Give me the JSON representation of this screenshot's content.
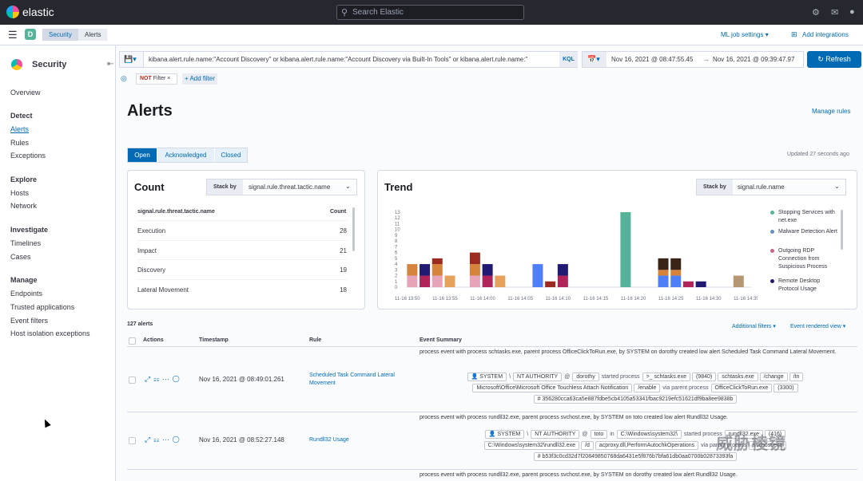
{
  "topbar": {
    "app_name": "elastic",
    "search_placeholder": "Search Elastic"
  },
  "header": {
    "space_badge": "D",
    "breadcrumbs": [
      "Security",
      "Alerts"
    ],
    "ml_job_settings": "ML job settings",
    "add_integrations": "Add integrations"
  },
  "sidebar": {
    "title": "Security",
    "items": [
      {
        "label": "Overview",
        "type": "link"
      },
      {
        "label": "Detect",
        "type": "heading"
      },
      {
        "label": "Alerts",
        "type": "link",
        "active": true
      },
      {
        "label": "Rules",
        "type": "link"
      },
      {
        "label": "Exceptions",
        "type": "link"
      },
      {
        "label": "Explore",
        "type": "heading"
      },
      {
        "label": "Hosts",
        "type": "link"
      },
      {
        "label": "Network",
        "type": "link"
      },
      {
        "label": "Investigate",
        "type": "heading"
      },
      {
        "label": "Timelines",
        "type": "link"
      },
      {
        "label": "Cases",
        "type": "link"
      },
      {
        "label": "Manage",
        "type": "heading"
      },
      {
        "label": "Endpoints",
        "type": "link"
      },
      {
        "label": "Trusted applications",
        "type": "link"
      },
      {
        "label": "Event filters",
        "type": "link"
      },
      {
        "label": "Host isolation exceptions",
        "type": "link"
      }
    ]
  },
  "query": {
    "text": "kibana.alert.rule.name:\"Account Discovery\" or kibana.alert.rule.name:\"Account Discovery via Built-In Tools\" or kibana.alert.rule.name:\"",
    "language": "KQL",
    "date_start": "Nov 16, 2021 @ 08:47:55.45",
    "date_end": "Nov 16, 2021 @ 09:39:47.97",
    "refresh": "Refresh",
    "filter_not": "NOT",
    "filter_label": "Filter",
    "add_filter": "+ Add filter"
  },
  "page": {
    "title": "Alerts",
    "manage_rules": "Manage rules",
    "tabs": [
      "Open",
      "Acknowledged",
      "Closed"
    ],
    "updated": "Updated 27 seconds ago"
  },
  "count_panel": {
    "title": "Count",
    "stack_by_label": "Stack by",
    "stack_by_value": "signal.rule.threat.tactic.name",
    "col_name": "signal.rule.threat.tactic.name",
    "col_count": "Count",
    "rows": [
      {
        "name": "Execution",
        "count": "28"
      },
      {
        "name": "Impact",
        "count": "21"
      },
      {
        "name": "Discovery",
        "count": "19"
      },
      {
        "name": "Lateral Movement",
        "count": "18"
      }
    ]
  },
  "trend_panel": {
    "title": "Trend",
    "stack_by_label": "Stack by",
    "stack_by_value": "signal.rule.name",
    "legend": [
      {
        "label": "Stopping Services with net.exe",
        "color": "#54b399"
      },
      {
        "label": "Malware Detection Alert",
        "color": "#6092c0"
      },
      {
        "label": "Outgoing RDP Connection from Suspicious Process",
        "color": "#d36086"
      },
      {
        "label": "Remote Desktop Protocol Usage",
        "color": "#211a73"
      }
    ]
  },
  "chart_data": {
    "type": "bar",
    "stacked": true,
    "ylim": [
      0,
      13
    ],
    "yticks": [
      0,
      1,
      2,
      3,
      4,
      5,
      6,
      7,
      8,
      9,
      10,
      11,
      12,
      13
    ],
    "xticks": [
      "11-16 13:50",
      "11-16 13:55",
      "11-16 14:00",
      "11-16 14:05",
      "11-16 14:10",
      "11-16 14:15",
      "11-16 14:20",
      "11-16 14:25",
      "11-16 14:30",
      "11-16 14:35"
    ],
    "grid": false,
    "legend_position": "right",
    "bars": [
      {
        "x": 13.85,
        "segments": [
          {
            "value": 2,
            "color": "#e7a4b9"
          },
          {
            "value": 2,
            "color": "#d6843c"
          }
        ]
      },
      {
        "x": 13.95,
        "segments": [
          {
            "value": 2,
            "color": "#b0245a"
          },
          {
            "value": 2,
            "color": "#211a73"
          }
        ]
      },
      {
        "x": 14.05,
        "segments": [
          {
            "value": 2,
            "color": "#e7a4b9"
          },
          {
            "value": 2,
            "color": "#d6843c"
          },
          {
            "value": 1,
            "color": "#9b2a20"
          }
        ]
      },
      {
        "x": 14.15,
        "segments": [
          {
            "value": 2,
            "color": "#e6a15b"
          }
        ]
      },
      {
        "x": 14.35,
        "segments": [
          {
            "value": 2,
            "color": "#e7a4b9"
          },
          {
            "value": 2,
            "color": "#d6843c"
          },
          {
            "value": 2,
            "color": "#9b2a20"
          }
        ]
      },
      {
        "x": 14.45,
        "segments": [
          {
            "value": 2,
            "color": "#b0245a"
          },
          {
            "value": 2,
            "color": "#211a73"
          }
        ]
      },
      {
        "x": 14.55,
        "segments": [
          {
            "value": 2,
            "color": "#e6a15b"
          }
        ]
      },
      {
        "x": 14.85,
        "segments": [
          {
            "value": 4,
            "color": "#4f7ff7"
          }
        ]
      },
      {
        "x": 14.95,
        "segments": [
          {
            "value": 1,
            "color": "#9b2a20"
          }
        ]
      },
      {
        "x": 15.05,
        "segments": [
          {
            "value": 2,
            "color": "#b0245a"
          },
          {
            "value": 2,
            "color": "#211a73"
          }
        ]
      },
      {
        "x": 15.55,
        "segments": [
          {
            "value": 13,
            "color": "#54b399"
          }
        ]
      },
      {
        "x": 15.85,
        "segments": [
          {
            "value": 2,
            "color": "#4f7ff7"
          },
          {
            "value": 1,
            "color": "#d6843c"
          },
          {
            "value": 2,
            "color": "#3a2418"
          }
        ]
      },
      {
        "x": 15.95,
        "segments": [
          {
            "value": 2,
            "color": "#4f7ff7"
          },
          {
            "value": 1,
            "color": "#d6843c"
          },
          {
            "value": 2,
            "color": "#3a2418"
          }
        ]
      },
      {
        "x": 16.05,
        "segments": [
          {
            "value": 1,
            "color": "#b0245a"
          }
        ]
      },
      {
        "x": 16.15,
        "segments": [
          {
            "value": 1,
            "color": "#211a73"
          }
        ]
      },
      {
        "x": 16.45,
        "segments": [
          {
            "value": 2,
            "color": "#b59773"
          }
        ]
      }
    ]
  },
  "table": {
    "count_label": "127 alerts",
    "additional_filters": "Additional filters",
    "event_rendered_view": "Event rendered view",
    "columns": [
      "Actions",
      "Timestamp",
      "Rule",
      "Event Summary"
    ],
    "rows": [
      {
        "timestamp": "Nov 16, 2021 @ 08:49:01.261",
        "rule": "Scheduled Task Command Lateral Movement",
        "summary": "process event with process schtasks.exe, parent process OfficeClickToRun.exe, by SYSTEM on dorothy created low alert Scheduled Task Command Lateral Movement.",
        "chips_line1": [
          "SYSTEM",
          "\\",
          "NT AUTHORITY",
          "@",
          "dorothy",
          "started process",
          "schtasks.exe",
          "(9840)",
          "schtasks.exe",
          "/change",
          "/tn"
        ],
        "chips_line2": [
          "Microsoft\\Office\\Microsoft Office Touchless Attach Notification",
          "/enable",
          "via parent process",
          "OfficeClickToRun.exe",
          "(3300)"
        ],
        "hash": "356280cca63ca5e887fdbe5cb4105a53341fbac9219efc51621df9ba8ee9838b"
      },
      {
        "timestamp": "Nov 16, 2021 @ 08:52:27.148",
        "rule": "Rundll32 Usage",
        "summary": "process event with process rundll32.exe, parent process svchost.exe, by SYSTEM on toto created low alert Rundll32 Usage.",
        "chips_line1": [
          "SYSTEM",
          "\\",
          "NT AUTHORITY",
          "@",
          "toto",
          "in",
          "C:\\Windows\\system32\\",
          "started process",
          "rundll32.exe",
          "(416)"
        ],
        "chips_line2": [
          "C:\\Windows\\system32\\rundll32.exe",
          "/d",
          "acproxy.dll,PerformAutochkOperations",
          "via parent process",
          "svchost.exe"
        ],
        "hash": "b53f3c0cd32d7f20849850768da6431e5f876b7bfa61db0aa0700b02873393fa"
      },
      {
        "summary": "process event with process rundll32.exe, parent process svchost.exe, by SYSTEM on dorothy created low alert Rundll32 Usage."
      }
    ]
  },
  "watermark": "威胁棱镜"
}
